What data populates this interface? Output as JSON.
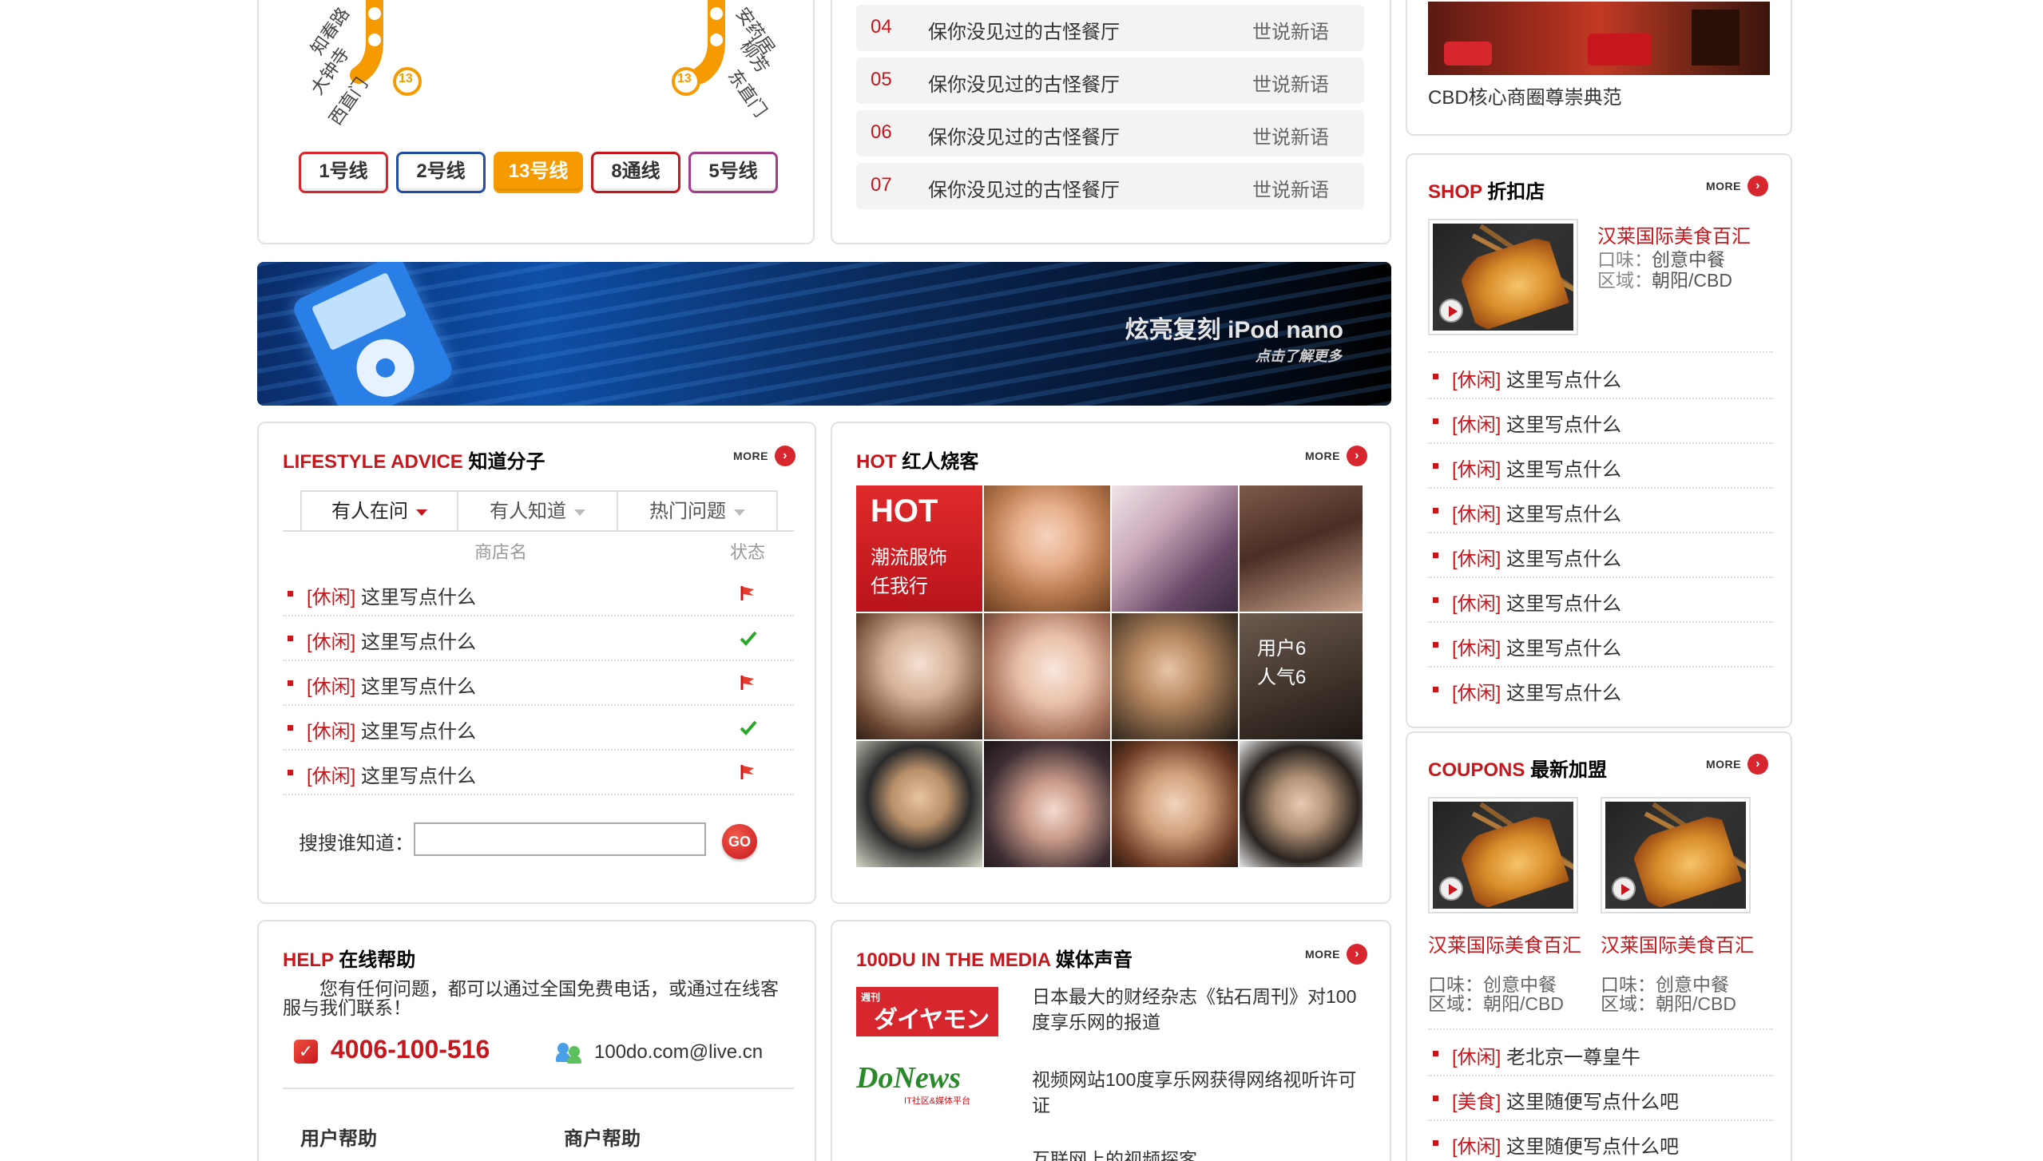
{
  "subway": {
    "stations_left": [
      "知春路",
      "大钟寺",
      "西直门"
    ],
    "stations_right": [
      "安药居",
      "柳芳",
      "东直门"
    ],
    "badge_left": "13",
    "badge_right": "13",
    "lines": [
      {
        "label": "1号线",
        "color": "#d8262e",
        "active": false
      },
      {
        "label": "2号线",
        "color": "#1f4fa8",
        "active": false
      },
      {
        "label": "13号线",
        "color": "#f59b00",
        "active": true
      },
      {
        "label": "8通线",
        "color": "#c8161d",
        "active": false
      },
      {
        "label": "5号线",
        "color": "#a23c8c",
        "active": false
      }
    ]
  },
  "ranking": {
    "rows": [
      {
        "no": "04",
        "name": "保你没见过的古怪餐厅",
        "src": "世说新语"
      },
      {
        "no": "05",
        "name": "保你没见过的古怪餐厅",
        "src": "世说新语"
      },
      {
        "no": "06",
        "name": "保你没见过的古怪餐厅",
        "src": "世说新语"
      },
      {
        "no": "07",
        "name": "保你没见过的古怪餐厅",
        "src": "世说新语"
      }
    ]
  },
  "cbd": {
    "caption": "CBD核心商圈尊崇典范"
  },
  "banner": {
    "text": "炫亮复刻 iPod nano",
    "sub": "点击了解更多"
  },
  "lifestyle": {
    "title_en": "LIFESTYLE ADVICE",
    "title_cn": "知道分子",
    "more": "MORE",
    "tabs": [
      "有人在问",
      "有人知道",
      "热门问题"
    ],
    "col_name": "商店名",
    "col_status": "状态",
    "items": [
      {
        "tag": "[休闲]",
        "text": "这里写点什么",
        "status": "flag"
      },
      {
        "tag": "[休闲]",
        "text": "这里写点什么",
        "status": "check"
      },
      {
        "tag": "[休闲]",
        "text": "这里写点什么",
        "status": "flag"
      },
      {
        "tag": "[休闲]",
        "text": "这里写点什么",
        "status": "check"
      },
      {
        "tag": "[休闲]",
        "text": "这里写点什么",
        "status": "flag"
      }
    ],
    "search_label": "搜搜谁知道：",
    "search_value": "",
    "go_label": "GO"
  },
  "hot": {
    "title_en": "HOT",
    "title_cn": "红人烧客",
    "more": "MORE",
    "promo_title": "HOT",
    "promo_line1": "潮流服饰",
    "promo_line2": "任我行",
    "user_label": "用户6",
    "user_pop": "人气6"
  },
  "shop": {
    "title_en": "SHOP",
    "title_cn": "折扣店",
    "more": "MORE",
    "featured_name": "汉莱国际美食百汇",
    "taste_label": "口味：",
    "taste_value": "创意中餐",
    "area_label": "区域：",
    "area_value": "朝阳/CBD",
    "items": [
      {
        "tag": "[休闲]",
        "text": "这里写点什么"
      },
      {
        "tag": "[休闲]",
        "text": "这里写点什么"
      },
      {
        "tag": "[休闲]",
        "text": "这里写点什么"
      },
      {
        "tag": "[休闲]",
        "text": "这里写点什么"
      },
      {
        "tag": "[休闲]",
        "text": "这里写点什么"
      },
      {
        "tag": "[休闲]",
        "text": "这里写点什么"
      },
      {
        "tag": "[休闲]",
        "text": "这里写点什么"
      },
      {
        "tag": "[休闲]",
        "text": "这里写点什么"
      }
    ]
  },
  "coupons": {
    "title_en": "COUPONS",
    "title_cn": "最新加盟",
    "more": "MORE",
    "cards": [
      {
        "name": "汉莱国际美食百汇",
        "taste": "口味：创意中餐",
        "area": "区域：朝阳/CBD"
      },
      {
        "name": "汉莱国际美食百汇",
        "taste": "口味：创意中餐",
        "area": "区域：朝阳/CBD"
      }
    ],
    "items": [
      {
        "tag": "[休闲]",
        "text": "老北京一尊皇牛"
      },
      {
        "tag": "[美食]",
        "text": "这里随便写点什么吧"
      },
      {
        "tag": "[休闲]",
        "text": "这里随便写点什么吧"
      }
    ]
  },
  "help": {
    "title_en": "HELP",
    "title_cn": "在线帮助",
    "desc": "您有任何问题，都可以通过全国免费电话，或通过在线客服与我们联系！",
    "phone": "4006-100-516",
    "email": "100do.com@live.cn",
    "link1": "用户帮助",
    "link2": "商户帮助"
  },
  "media": {
    "title_en": "100DU IN THE MEDIA",
    "title_cn": "媒体声音",
    "more": "MORE",
    "items": [
      {
        "logo": "ダイヤモンド",
        "logo_top": "週刊",
        "text": "日本最大的财经杂志《钻石周刊》对100度享乐网的报道"
      },
      {
        "logo": "DoNews",
        "logo_top": "IT社区&媒体平台",
        "text": "视频网站100度享乐网获得网络视听许可证"
      },
      {
        "logo": "",
        "logo_top": "",
        "text": "互联网上的视频探客"
      }
    ]
  }
}
